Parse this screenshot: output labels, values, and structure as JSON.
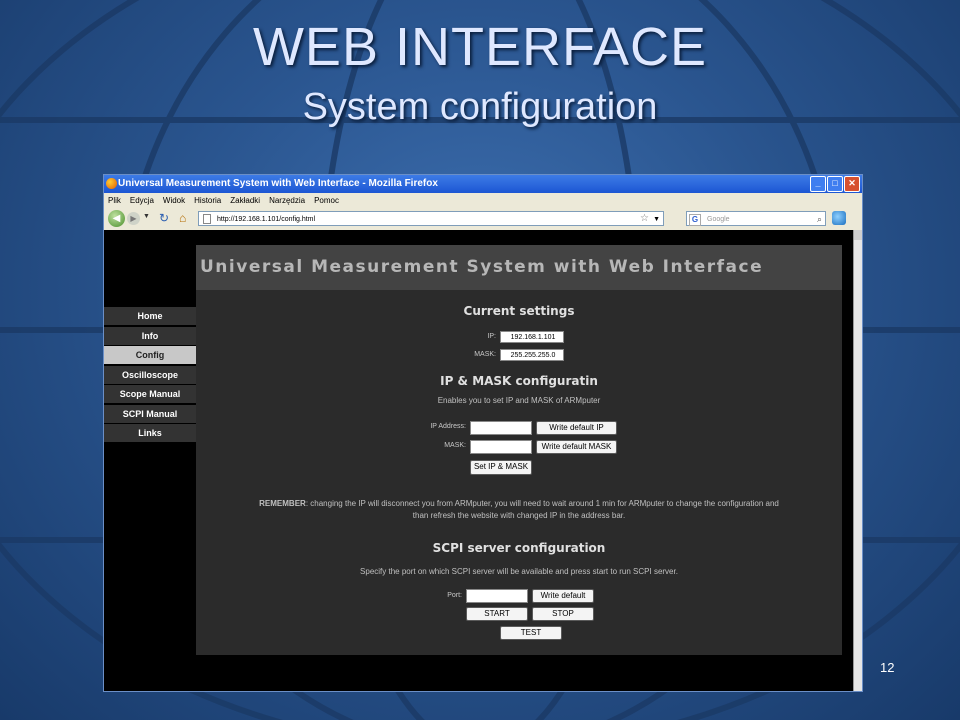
{
  "slide": {
    "title": "WEB INTERFACE",
    "subtitle": "System configuration",
    "page_number": "12"
  },
  "browser": {
    "window_title": "Universal Measurement System with Web Interface - Mozilla Firefox",
    "menu": [
      "Plik",
      "Edycja",
      "Widok",
      "Historia",
      "Zakładki",
      "Narzędzia",
      "Pomoc"
    ],
    "url": "http://192.168.1.101/config.html",
    "search_placeholder": "Google"
  },
  "site": {
    "header": "Universal Measurement System with Web Interface",
    "nav": [
      {
        "label": "Home",
        "active": false
      },
      {
        "label": "Info",
        "active": false
      },
      {
        "label": "Config",
        "active": true
      },
      {
        "label": "Oscilloscope",
        "active": false
      },
      {
        "label": "Scope Manual",
        "active": false
      },
      {
        "label": "SCPI Manual",
        "active": false
      },
      {
        "label": "Links",
        "active": false
      }
    ],
    "current": {
      "title": "Current settings",
      "ip_label": "IP:",
      "ip_value": "192.168.1.101",
      "mask_label": "MASK:",
      "mask_value": "255.255.255.0"
    },
    "ipmask": {
      "title": "IP & MASK configuratin",
      "description": "Enables you to set IP and MASK of ARMputer",
      "ip_label": "IP Address:",
      "mask_label": "MASK:",
      "write_ip": "Write default IP",
      "write_mask": "Write default MASK",
      "set": "Set IP & MASK"
    },
    "remember": {
      "bold": "REMEMBER",
      "line1": ": changing the IP will disconnect you from ARMputer, you will need to wait around 1 min for ARMputer to change the configuration and",
      "line2": "than refresh the website with changed IP in the address bar."
    },
    "scpi": {
      "title": "SCPI server configuration",
      "description": "Specify the port on which SCPI server will be available and press start to run SCPI server.",
      "port_label": "Port:",
      "write_default": "Write default",
      "start": "START",
      "stop": "STOP",
      "test": "TEST"
    }
  }
}
